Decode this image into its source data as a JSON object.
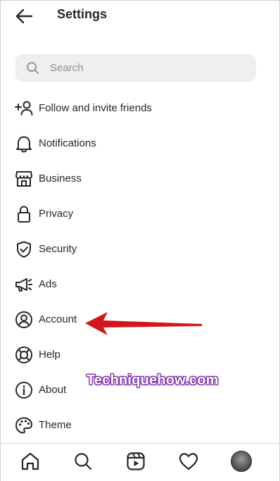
{
  "header": {
    "title": "Settings",
    "back_icon": "arrow-left-icon"
  },
  "search": {
    "placeholder": "Search",
    "icon": "search-icon"
  },
  "menu": {
    "items": [
      {
        "label": "Follow and invite friends",
        "icon": "add-person-icon"
      },
      {
        "label": "Notifications",
        "icon": "bell-icon"
      },
      {
        "label": "Business",
        "icon": "shop-icon"
      },
      {
        "label": "Privacy",
        "icon": "lock-icon"
      },
      {
        "label": "Security",
        "icon": "shield-check-icon"
      },
      {
        "label": "Ads",
        "icon": "megaphone-icon"
      },
      {
        "label": "Account",
        "icon": "user-circle-icon"
      },
      {
        "label": "Help",
        "icon": "lifebuoy-icon"
      },
      {
        "label": "About",
        "icon": "info-icon"
      },
      {
        "label": "Theme",
        "icon": "palette-icon"
      }
    ]
  },
  "annotation": {
    "watermark": "Techniquehow.com",
    "arrow_color": "#d3161a",
    "watermark_glow": "#6a1b9a"
  },
  "bottom_nav": {
    "items": [
      "home-icon",
      "search-icon",
      "reels-icon",
      "heart-icon",
      "profile-avatar"
    ]
  }
}
